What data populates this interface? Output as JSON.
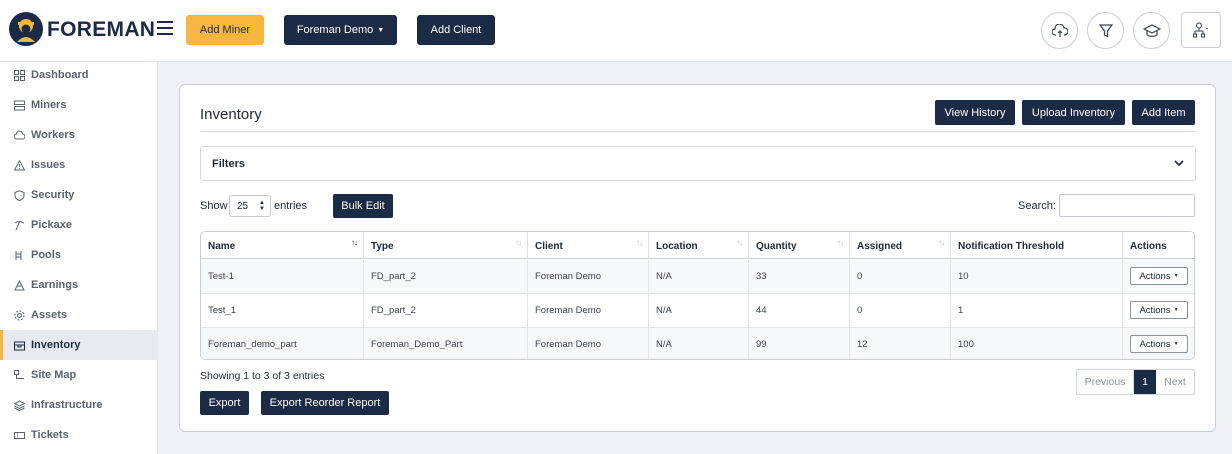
{
  "brand": {
    "name": "FOREMAN"
  },
  "topbar": {
    "add_miner": "Add Miner",
    "org_select": "Foreman Demo",
    "add_client": "Add Client",
    "icons": [
      "cloud-upload-icon",
      "filter-icon",
      "graduation-cap-icon",
      "user-network-icon"
    ]
  },
  "sidebar": {
    "items": [
      {
        "label": "Dashboard",
        "icon": "dashboard-icon"
      },
      {
        "label": "Miners",
        "icon": "server-icon"
      },
      {
        "label": "Workers",
        "icon": "cloud-icon"
      },
      {
        "label": "Issues",
        "icon": "warning-icon"
      },
      {
        "label": "Security",
        "icon": "shield-icon"
      },
      {
        "label": "Pickaxe",
        "icon": "pickaxe-icon"
      },
      {
        "label": "Pools",
        "icon": "pool-icon"
      },
      {
        "label": "Earnings",
        "icon": "coins-icon"
      },
      {
        "label": "Assets",
        "icon": "gear-icon"
      },
      {
        "label": "Inventory",
        "icon": "box-icon",
        "active": true
      },
      {
        "label": "Site Map",
        "icon": "map-icon"
      },
      {
        "label": "Infrastructure",
        "icon": "layers-icon"
      },
      {
        "label": "Tickets",
        "icon": "ticket-icon"
      }
    ]
  },
  "inventory": {
    "title": "Inventory",
    "view_history": "View History",
    "upload_inventory": "Upload Inventory",
    "add_item": "Add Item",
    "filters_label": "Filters",
    "show_label": "Show",
    "entries_value": "25",
    "entries_label": "entries",
    "bulk_edit": "Bulk Edit",
    "search_label": "Search:",
    "search_value": "",
    "columns": [
      "Name",
      "Type",
      "Client",
      "Location",
      "Quantity",
      "Assigned",
      "Notification Threshold",
      "Actions"
    ],
    "rows": [
      {
        "name": "Test-1",
        "type": "FD_part_2",
        "client": "Foreman Demo",
        "location": "N/A",
        "quantity": "33",
        "assigned": "0",
        "threshold": "10",
        "actions": "Actions"
      },
      {
        "name": "Test_1",
        "type": "FD_part_2",
        "client": "Foreman Demo",
        "location": "N/A",
        "quantity": "44",
        "assigned": "0",
        "threshold": "1",
        "actions": "Actions"
      },
      {
        "name": "Foreman_demo_part",
        "type": "Foreman_Demo_Part",
        "client": "Foreman Demo",
        "location": "N/A",
        "quantity": "99",
        "assigned": "12",
        "threshold": "100",
        "actions": "Actions"
      }
    ],
    "showing": "Showing 1 to 3 of 3 entries",
    "pager": {
      "previous": "Previous",
      "current": "1",
      "next": "Next"
    },
    "export": "Export",
    "export_reorder": "Export Reorder Report"
  },
  "colors": {
    "navy": "#1c2b45",
    "accent": "#f6b73c"
  }
}
